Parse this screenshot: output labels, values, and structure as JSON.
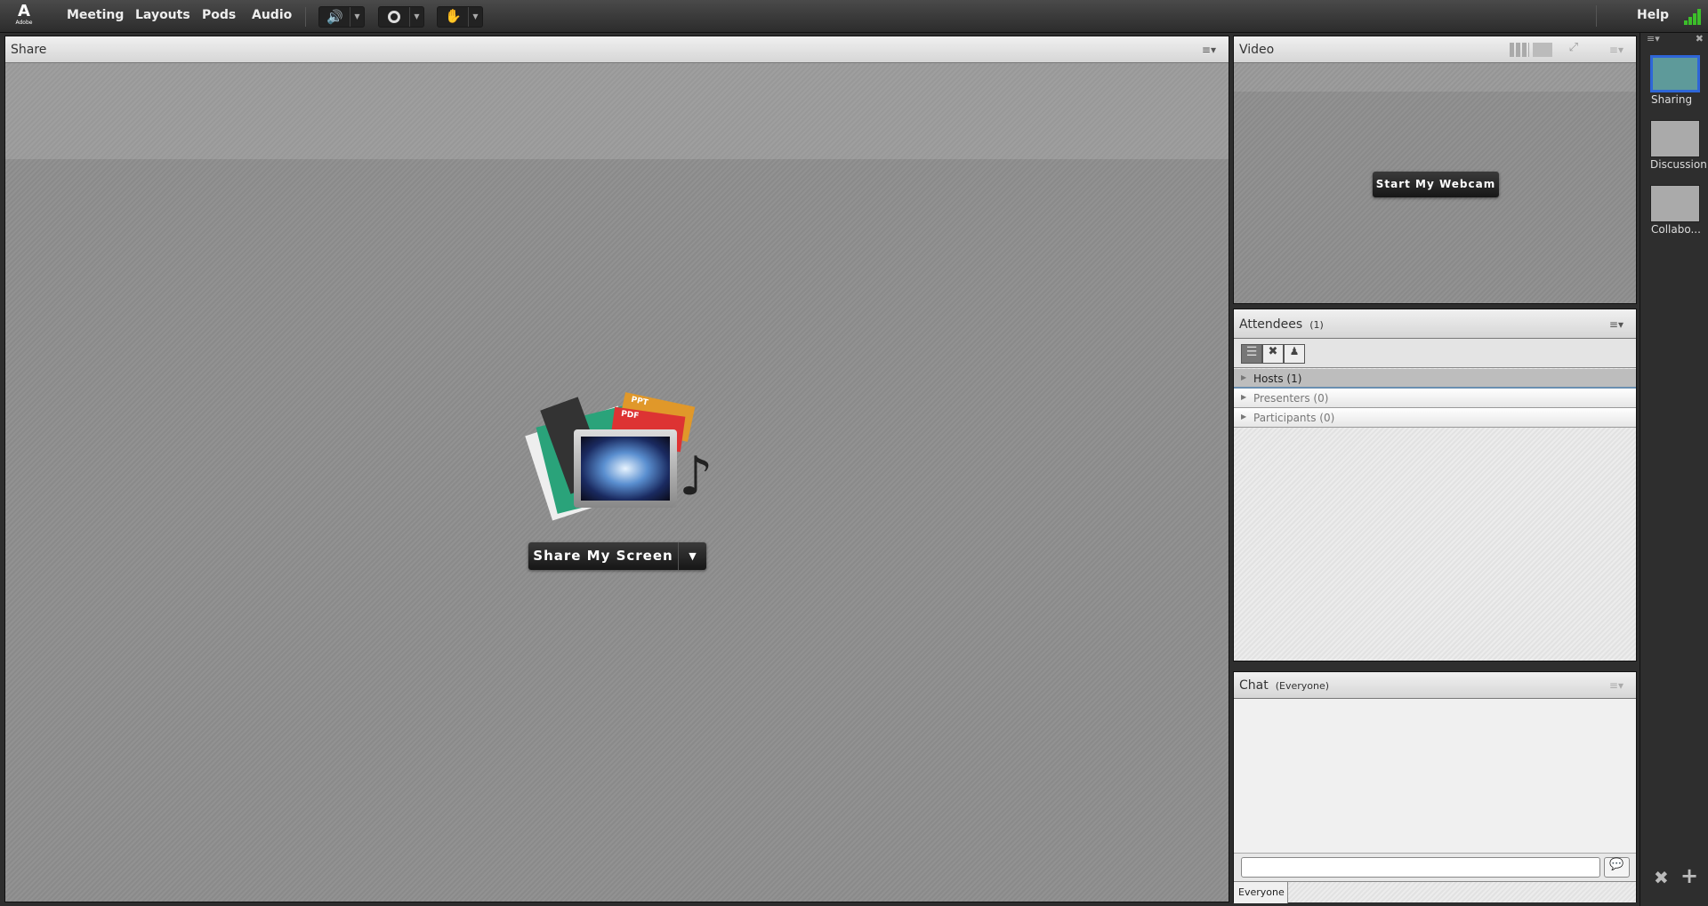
{
  "topbar": {
    "logo": "Adobe",
    "menus": [
      "Meeting",
      "Layouts",
      "Pods",
      "Audio"
    ],
    "help": "Help",
    "speaker_color": "#7ccc2a",
    "signal_color": "#3cbf2a"
  },
  "share": {
    "title": "Share",
    "button": "Share My Screen",
    "file_labels": [
      "PPT",
      "PDF"
    ]
  },
  "video": {
    "title": "Video",
    "button": "Start My Webcam"
  },
  "attendees": {
    "title": "Attendees",
    "count": "(1)",
    "groups": [
      "Hosts (1)",
      "Presenters (0)",
      "Participants (0)"
    ]
  },
  "chat": {
    "title": "Chat",
    "scope": "(Everyone)",
    "input_value": "",
    "tab": "Everyone"
  },
  "layouts": [
    {
      "label": "Sharing",
      "selected": true
    },
    {
      "label": "Discussion",
      "selected": false
    },
    {
      "label": "Collabo...",
      " selected": false
    }
  ]
}
